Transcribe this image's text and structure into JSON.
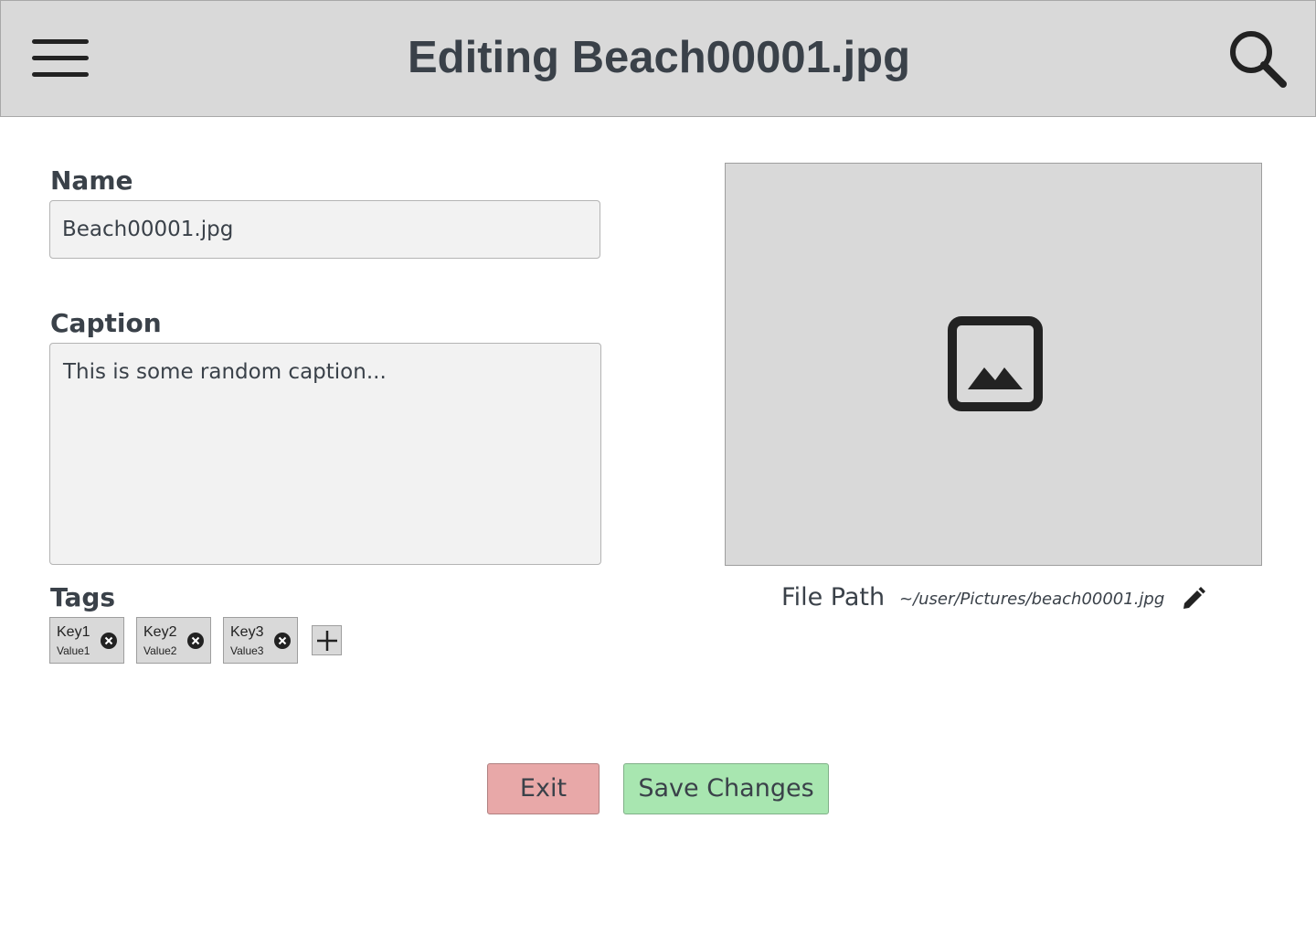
{
  "header": {
    "title": "Editing Beach00001.jpg",
    "menu_icon": "hamburger-menu-icon",
    "search_icon": "magnifying-glass-icon"
  },
  "form": {
    "name_label": "Name",
    "name_value": "Beach00001.jpg",
    "caption_label": "Caption",
    "caption_value": "This is some random caption...",
    "tags_label": "Tags"
  },
  "tags": [
    {
      "key": "Key1",
      "value": "Value1"
    },
    {
      "key": "Key2",
      "value": "Value2"
    },
    {
      "key": "Key3",
      "value": "Value3"
    }
  ],
  "preview": {
    "icon": "image-placeholder-icon"
  },
  "file_path": {
    "label": "File Path",
    "value": "~/user/Pictures/beach00001.jpg"
  },
  "actions": {
    "exit_label": "Exit",
    "save_label": "Save Changes"
  },
  "colors": {
    "header_bg": "#d9d9d9",
    "exit_bg": "#e8a8a8",
    "save_bg": "#a8e6b0",
    "text": "#3a4149"
  }
}
